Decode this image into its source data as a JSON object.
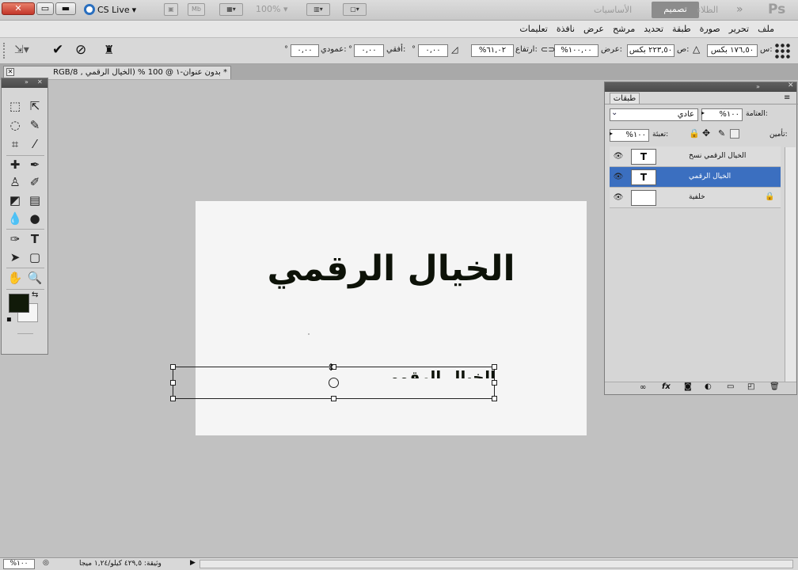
{
  "appbar": {
    "close_label": "✕",
    "cslive": "CS Live",
    "bridge_icon": "Br-icon",
    "minibridge": "Mb",
    "zoom": "100%",
    "ps_logo": "Ps",
    "workspace_chevrons": "»",
    "workspace_clouds": "الظلاء",
    "workspace_design": "تصميم",
    "workspace_basics": "الأساسيات"
  },
  "menus": [
    "ملف",
    "تحرير",
    "صورة",
    "طبقة",
    "تحديد",
    "مرشح",
    "عرض",
    "نافذة",
    "تعليمات"
  ],
  "options": {
    "x_label": "س:",
    "x_value": "١٧٦,٥٠ بكس",
    "y_label": "ص:",
    "y_value": "٢٢٣,٥٠ بكس",
    "w_label": "عرض:",
    "w_value": "%١٠٠,٠٠",
    "h_label": "ارتفاع:",
    "h_value": "%٦١,٠٢",
    "angle_value": "٠,٠٠",
    "hskew_label": "أفقي:",
    "hskew_value": "٠,٠٠",
    "vskew_label": "عمودي:",
    "vskew_value": "٠,٠٠",
    "degree": "°"
  },
  "document": {
    "tab_title": "* بدون عنوان-١ @ 100 % (الخيال الرقمي , RGB/8",
    "tab_close": "✕"
  },
  "canvas": {
    "main_text": "الخيال الرقمي",
    "copy_text": "الخيال الرقمي"
  },
  "layers_panel": {
    "tab": "طبقات",
    "opacity_label": "العتامة:",
    "opacity_value": "%١٠٠",
    "blend_mode": "عادي",
    "lock_label": "تأمين:",
    "fill_label": "تعبئة:",
    "fill_value": "%١٠٠",
    "layers": [
      {
        "name": "الخيال الرقمي نسخ",
        "thumb": "T",
        "selected": false
      },
      {
        "name": "الخيال الرقمي",
        "thumb": "T",
        "selected": true
      },
      {
        "name": "خلفية",
        "thumb": "",
        "selected": false
      }
    ],
    "footer_icons": [
      "link-icon",
      "fx-icon",
      "mask-icon",
      "adjustment-icon",
      "folder-icon",
      "new-layer-icon",
      "trash-icon"
    ]
  },
  "status": {
    "zoom": "%١٠٠",
    "doc_info": "وثيقة: ٤٢٩,٥ كيلو/١,٢٤ ميجا"
  },
  "colors": {
    "selection": "#3b6fc0",
    "foreground": "#111a09",
    "background": "#f5f5f5"
  }
}
